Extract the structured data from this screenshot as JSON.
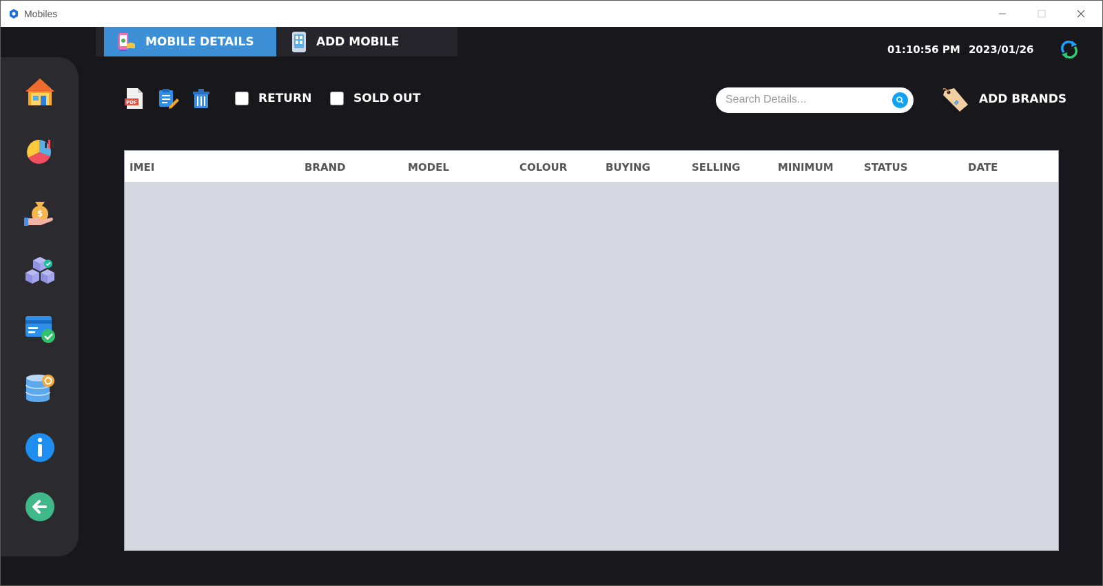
{
  "window": {
    "title": "Mobiles"
  },
  "tabs": [
    {
      "label": "MOBILE DETAILS",
      "active": true,
      "icon": "mobile-details-icon"
    },
    {
      "label": "ADD MOBILE",
      "active": false,
      "icon": "add-mobile-icon"
    }
  ],
  "header": {
    "time": "01:10:56 PM",
    "date": "2023/01/26"
  },
  "sidebar": {
    "items": [
      {
        "icon": "home-icon"
      },
      {
        "icon": "pie-chart-icon"
      },
      {
        "icon": "money-bag-icon"
      },
      {
        "icon": "boxes-icon"
      },
      {
        "icon": "card-check-icon"
      },
      {
        "icon": "database-icon"
      },
      {
        "icon": "info-icon"
      },
      {
        "icon": "back-arrow-icon"
      }
    ]
  },
  "toolbar": {
    "return_label": "RETURN",
    "sold_out_label": "SOLD OUT",
    "add_brands_label": "ADD BRANDS"
  },
  "search": {
    "placeholder": "Search Details...",
    "value": ""
  },
  "table": {
    "columns": [
      "IMEI",
      "BRAND",
      "MODEL",
      "COLOUR",
      "BUYING",
      "SELLING",
      "MINIMUM",
      "STATUS",
      "DATE"
    ],
    "rows": []
  },
  "colors": {
    "accent": "#3d8fd6",
    "background": "#17171c",
    "sidebar": "#2a2a2f",
    "table_body": "#d5d8e0"
  }
}
